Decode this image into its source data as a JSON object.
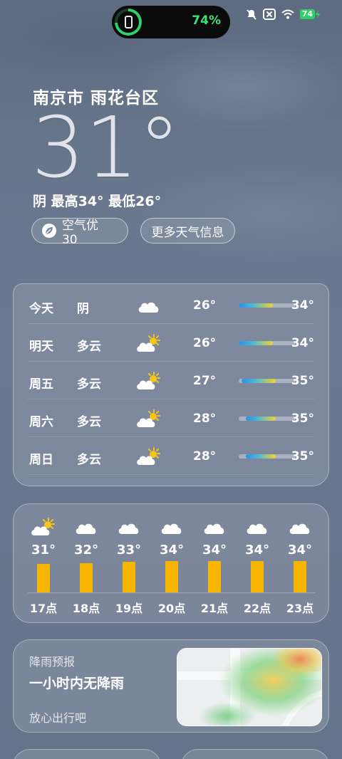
{
  "status_bar": {
    "battery_pill_percent": "74%",
    "battery_level": "74",
    "icons": [
      "bell-off-icon",
      "close-box-icon",
      "wifi-icon",
      "battery-charging-icon"
    ]
  },
  "location": {
    "city": "南京市 雨花台区"
  },
  "current": {
    "temperature": "31°",
    "summary": "阴 最高34° 最低26°",
    "aqi_label": "空气优 30",
    "more_info_label": "更多天气信息"
  },
  "daily": [
    {
      "day": "今天",
      "condition": "阴",
      "icon": "cloud-icon",
      "low": "26°",
      "high": "34°",
      "range": [
        0.0,
        0.6
      ]
    },
    {
      "day": "明天",
      "condition": "多云",
      "icon": "partly-cloudy-icon",
      "low": "26°",
      "high": "34°",
      "range": [
        0.0,
        0.6
      ]
    },
    {
      "day": "周五",
      "condition": "多云",
      "icon": "partly-cloudy-icon",
      "low": "27°",
      "high": "35°",
      "range": [
        0.05,
        0.65
      ]
    },
    {
      "day": "周六",
      "condition": "多云",
      "icon": "partly-cloudy-icon",
      "low": "28°",
      "high": "35°",
      "range": [
        0.12,
        0.65
      ]
    },
    {
      "day": "周日",
      "condition": "多云",
      "icon": "partly-cloudy-icon",
      "low": "28°",
      "high": "35°",
      "range": [
        0.12,
        0.65
      ]
    }
  ],
  "hourly": [
    {
      "time": "17点",
      "temp": "31°",
      "value": 31,
      "icon": "partly-cloudy-icon"
    },
    {
      "time": "18点",
      "temp": "32°",
      "value": 32,
      "icon": "cloud-icon"
    },
    {
      "time": "19点",
      "temp": "33°",
      "value": 33,
      "icon": "cloud-icon"
    },
    {
      "time": "20点",
      "temp": "34°",
      "value": 34,
      "icon": "cloud-icon"
    },
    {
      "time": "21点",
      "temp": "34°",
      "value": 34,
      "icon": "cloud-icon"
    },
    {
      "time": "22点",
      "temp": "34°",
      "value": 34,
      "icon": "cloud-icon"
    },
    {
      "time": "23点",
      "temp": "34°",
      "value": 34,
      "icon": "cloud-icon"
    }
  ],
  "rain": {
    "title": "降雨预报",
    "headline": "一小时内无降雨",
    "subtitle": "放心出行吧"
  },
  "colors": {
    "accent_green": "#2fd06a",
    "hourly_bar": "#f7b500",
    "bar_gradient": [
      "#2a8fe8",
      "#f2d230"
    ]
  }
}
